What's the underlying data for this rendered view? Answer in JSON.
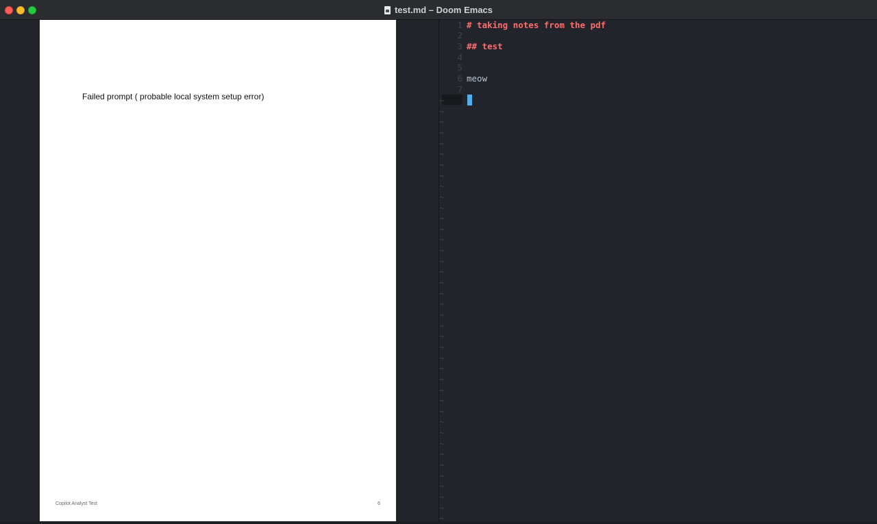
{
  "window": {
    "title": "test.md – Doom Emacs"
  },
  "pdf": {
    "body_text": "Failed prompt ( probable local system setup error)",
    "footer_left": "Copilot Analyst Test",
    "page_number": "6"
  },
  "editor": {
    "lines": [
      {
        "num": "1",
        "text": "# taking notes from the pdf",
        "style": "h1"
      },
      {
        "num": "2",
        "text": "",
        "style": "plain"
      },
      {
        "num": "3",
        "text": "## test",
        "style": "h1"
      },
      {
        "num": "4",
        "text": "",
        "style": "plain"
      },
      {
        "num": "5",
        "text": "",
        "style": "plain"
      },
      {
        "num": "6",
        "text": "meow",
        "style": "plain"
      },
      {
        "num": "7",
        "text": "",
        "style": "plain"
      }
    ],
    "tilde": "~"
  },
  "colors": {
    "heading": "#ff6c6b",
    "text": "#bbc2cf",
    "cursor": "#51afef",
    "editor_bg": "#21242b"
  }
}
